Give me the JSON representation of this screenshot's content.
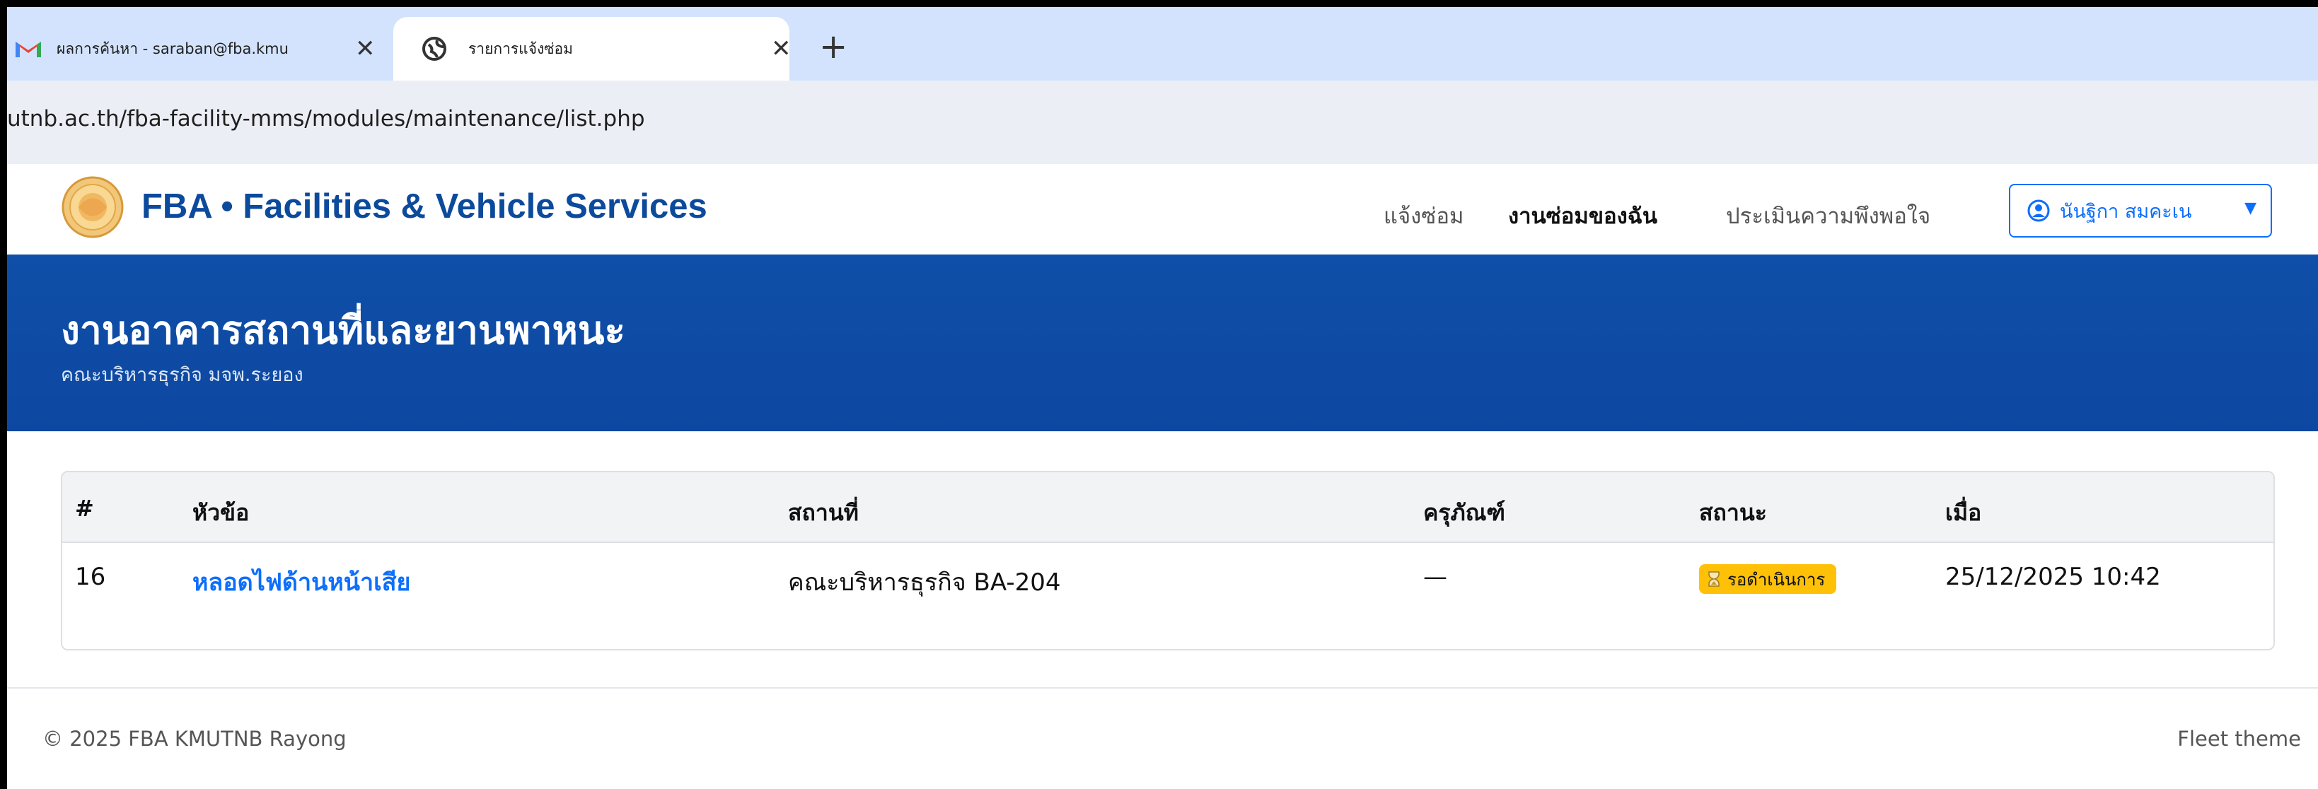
{
  "browser": {
    "tabs": [
      {
        "label": "ผลการค้นหา - saraban@fba.kmu",
        "close": "✕"
      },
      {
        "label": "รายการแจ้งซ่อม",
        "close": "✕"
      }
    ],
    "new_tab": "+",
    "url": "utnb.ac.th/fba-facility-mms/modules/maintenance/list.php"
  },
  "navbar": {
    "brand": "FBA • Facilities & Vehicle Services",
    "links": [
      "แจ้งซ่อม",
      "งานซ่อมของฉัน",
      "ประเมินความพึงพอใจ"
    ],
    "user": "นันฐิกา สมคะเน"
  },
  "hero": {
    "title": "งานอาคารสถานที่และยานพาหนะ",
    "subtitle": "คณะบริหารธุรกิจ มจพ.ระยอง"
  },
  "table": {
    "headers": [
      "#",
      "หัวข้อ",
      "สถานที่",
      "ครุภัณฑ์",
      "สถานะ",
      "เมื่อ"
    ],
    "rows": [
      {
        "id": "16",
        "title": "หลอดไฟด้านหน้าเสีย",
        "location": "คณะบริหารธุรกิจ BA-204",
        "equipment": "—",
        "status": "รอดำเนินการ",
        "when": "25/12/2025 10:42"
      }
    ]
  },
  "footer": {
    "copyright": "© 2025 FBA KMUTNB Rayong",
    "theme": "Fleet theme"
  },
  "colors": {
    "brand": "#0c4a9c",
    "hero": "#0d47a1",
    "link": "#0d6efd",
    "status_pending": "#ffc107"
  }
}
